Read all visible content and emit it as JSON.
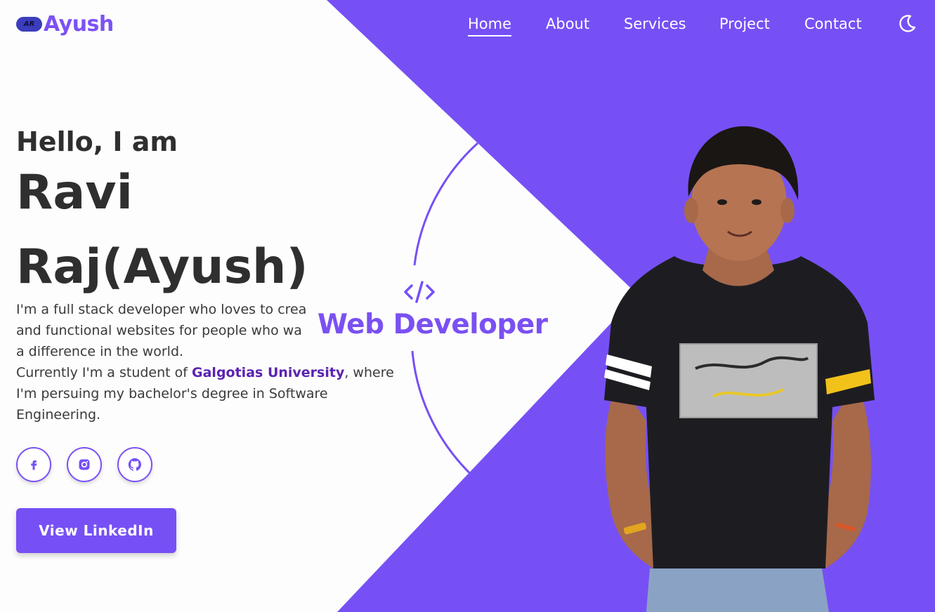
{
  "brand": {
    "badge": "AR",
    "name": "Ayush"
  },
  "nav": {
    "items": [
      {
        "label": "Home",
        "active": true
      },
      {
        "label": "About",
        "active": false
      },
      {
        "label": "Services",
        "active": false
      },
      {
        "label": "Project",
        "active": false
      },
      {
        "label": "Contact",
        "active": false
      }
    ],
    "theme_icon": "moon-icon"
  },
  "hero": {
    "greeting": "Hello, I am",
    "name": "Ravi Raj(Ayush)",
    "description_1": "I'm a full stack developer who loves to crea",
    "description_2": "and functional websites for people who wa",
    "description_3": "a difference in the world.",
    "description_4": "Currently I'm a student of ",
    "university": "Galgotias University",
    "description_5": ", where",
    "description_6": "I'm persuing my bachelor's degree in Software",
    "description_7": "Engineering.",
    "socials": [
      "facebook-icon",
      "instagram-icon",
      "github-icon"
    ],
    "cta_label": "View LinkedIn",
    "role": "Web Developer",
    "role_icon": "code-icon"
  },
  "colors": {
    "accent": "#7650f5",
    "university": "#5b23b0",
    "text": "#2f2f2f"
  }
}
